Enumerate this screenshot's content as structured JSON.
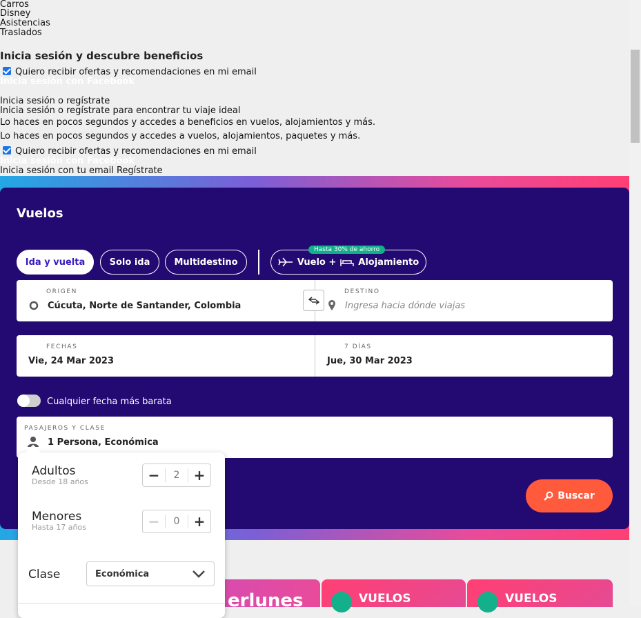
{
  "top_links": [
    "Carros",
    "Disney",
    "Asistencias",
    "Traslados"
  ],
  "login": {
    "heading": "Inicia sesión y descubre beneficios",
    "newsletter_label": "Quiero recibir ofertas y recomendaciones en mi email",
    "facebook": "Inicia sesión con Facebook",
    "login_or_register": "Inicia sesión o regístrate",
    "login_or_register_full": "Inicia sesión o regístrate para encontrar tu viaje ideal",
    "benefits_text": "Lo haces en pocos segundos y accedes a beneficios en vuelos, alojamientos y más.",
    "access_text": "Lo haces en pocos segundos y accedes a vuelos, alojamientos, paquetes y más.",
    "newsletter_label_2": "Quiero recibir ofertas y recomendaciones en mi email",
    "facebook_2": "Inicia sesión con Facebook",
    "email_login": "Inicia sesión con tu email",
    "register": "Regístrate"
  },
  "search": {
    "title": "Vuelos",
    "trip_types": [
      "Ida y vuelta",
      "Solo ida",
      "Multidestino"
    ],
    "combo_label_flight": "Vuelo +",
    "combo_label_hotel": "Alojamiento",
    "promo_badge": "Hasta 30% de ahorro",
    "origin_label": "ORIGEN",
    "origin_value": "Cúcuta, Norte de Santander, Colombia",
    "destination_label": "DESTINO",
    "destination_placeholder": "Ingresa hacia dónde viajas",
    "dates_label": "FECHAS",
    "depart_date": "Vie, 24 Mar 2023",
    "duration_label": "7 DÍAS",
    "return_date": "Jue, 30 Mar 2023",
    "flexible_label": "Cualquier fecha más barata",
    "pax_label": "PASAJEROS Y CLASE",
    "pax_value": "1 Persona, Económica",
    "search_button": "Buscar"
  },
  "passengers": {
    "adults_title": "Adultos",
    "adults_sub": "Desde 18 años",
    "adults_count": "2",
    "minors_title": "Menores",
    "minors_sub": "Hasta 17 años",
    "minors_count": "0",
    "class_title": "Clase",
    "class_value": "Económica"
  },
  "promo_cards": {
    "card1_text": "erlunes",
    "card2_text": "VUELOS",
    "card3_text": "VUELOS"
  },
  "colors": {
    "panel": "#230a72",
    "accent": "#ff5a3c",
    "promo_badge": "#14b08c"
  }
}
